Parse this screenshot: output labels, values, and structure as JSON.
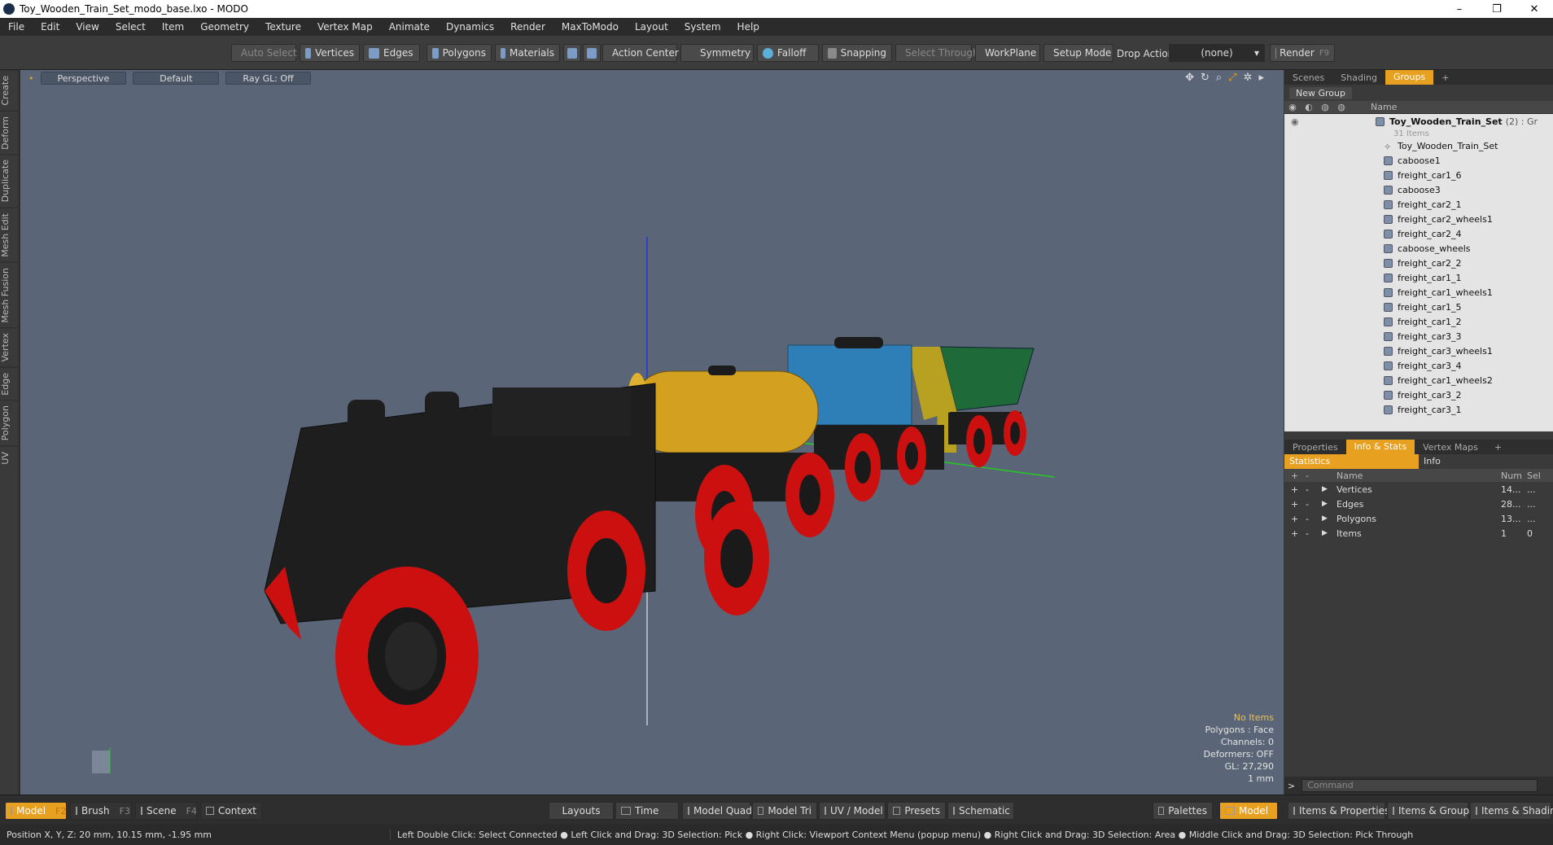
{
  "window": {
    "title": "Toy_Wooden_Train_Set_modo_base.lxo - MODO",
    "minimize": "–",
    "restore": "❐",
    "close": "✕"
  },
  "menu": [
    "File",
    "Edit",
    "View",
    "Select",
    "Item",
    "Geometry",
    "Texture",
    "Vertex Map",
    "Animate",
    "Dynamics",
    "Render",
    "MaxToModo",
    "Layout",
    "System",
    "Help"
  ],
  "toolbar": {
    "auto_select": "Auto Select",
    "vertices": "Vertices",
    "edges": "Edges",
    "polygons": "Polygons",
    "materials": "Materials",
    "action_center": "Action Center",
    "symmetry": "Symmetry",
    "falloff": "Falloff",
    "snapping": "Snapping",
    "select_through": "Select Through",
    "workplane": "WorkPlane",
    "setup_mode": "Setup Mode",
    "drop_action": "Drop Action",
    "drop_action_value": "(none)",
    "render": "Render",
    "render_key": "F9"
  },
  "left_tabs": [
    "Create",
    "Deform",
    "Duplicate",
    "Mesh Edit",
    "Mesh Fusion",
    "Vertex",
    "Edge",
    "Polygon",
    "UV"
  ],
  "viewport": {
    "view": "Perspective",
    "shading": "Default",
    "raygl": "Ray GL: Off",
    "info": {
      "no_items": "No Items",
      "polygons": "Polygons : Face",
      "channels": "Channels: 0",
      "deformers": "Deformers: OFF",
      "gl": "GL: 27,290",
      "unit": "1 mm"
    }
  },
  "scene_panel": {
    "tabs": [
      "Scenes",
      "Shading",
      "Groups",
      "+"
    ],
    "active_tab": "Groups",
    "new_group": "New Group",
    "name_header": "Name",
    "root": "Toy_Wooden_Train_Set",
    "root_suffix": "(2) : Gr",
    "root_count": "31 Items",
    "items": [
      "Toy_Wooden_Train_Set",
      "caboose1",
      "freight_car1_6",
      "caboose3",
      "freight_car2_1",
      "freight_car2_wheels1",
      "freight_car2_4",
      "caboose_wheels",
      "freight_car2_2",
      "freight_car1_1",
      "freight_car1_wheels1",
      "freight_car1_5",
      "freight_car1_2",
      "freight_car3_3",
      "freight_car3_wheels1",
      "freight_car3_4",
      "freight_car1_wheels2",
      "freight_car3_2",
      "freight_car3_1"
    ]
  },
  "stats_panel": {
    "tabs": [
      "Properties",
      "Info & Stats",
      "Vertex Maps",
      "+"
    ],
    "active_tab": "Info & Stats",
    "sub_tabs": [
      "Statistics",
      "Info"
    ],
    "headers": {
      "name": "Name",
      "num": "Num",
      "sel": "Sel"
    },
    "rows": [
      {
        "name": "Vertices",
        "num": "14...",
        "sel": "..."
      },
      {
        "name": "Edges",
        "num": "28...",
        "sel": "..."
      },
      {
        "name": "Polygons",
        "num": "13...",
        "sel": "..."
      },
      {
        "name": "Items",
        "num": "1",
        "sel": "0"
      }
    ],
    "command_placeholder": "Command"
  },
  "bottom": {
    "model": "Model",
    "model_key": "F2",
    "brush": "Brush",
    "brush_key": "F3",
    "scene": "Scene",
    "scene_key": "F4",
    "context": "Context",
    "layouts": "Layouts",
    "time": "Time",
    "model_quad": "Model Quad",
    "model_tri": "Model Tri",
    "uv_model": "UV / Model",
    "presets": "Presets",
    "schematic": "Schematic",
    "palettes": "Palettes",
    "model2": "Model",
    "items_properties": "Items & Properties",
    "items_groups": "Items & Groups",
    "items_shading": "Items & Shading"
  },
  "status": {
    "position": "Position X, Y, Z:  20 mm, 10.15 mm, -1.95 mm",
    "hints": "Left Double Click: Select Connected ● Left Click and Drag: 3D Selection: Pick ● Right Click: Viewport Context Menu (popup menu) ● Right Click and Drag: 3D Selection: Area ● Middle Click and Drag: 3D Selection: Pick Through"
  },
  "colors": {
    "accent": "#e8a020",
    "viewport_bg": "#5a6677",
    "engine": "#1e1e1e",
    "wheels": "#d01010",
    "tanker": "#d4a020",
    "boxcar": "#2e7fb8",
    "hopper": "#1e6a38"
  }
}
